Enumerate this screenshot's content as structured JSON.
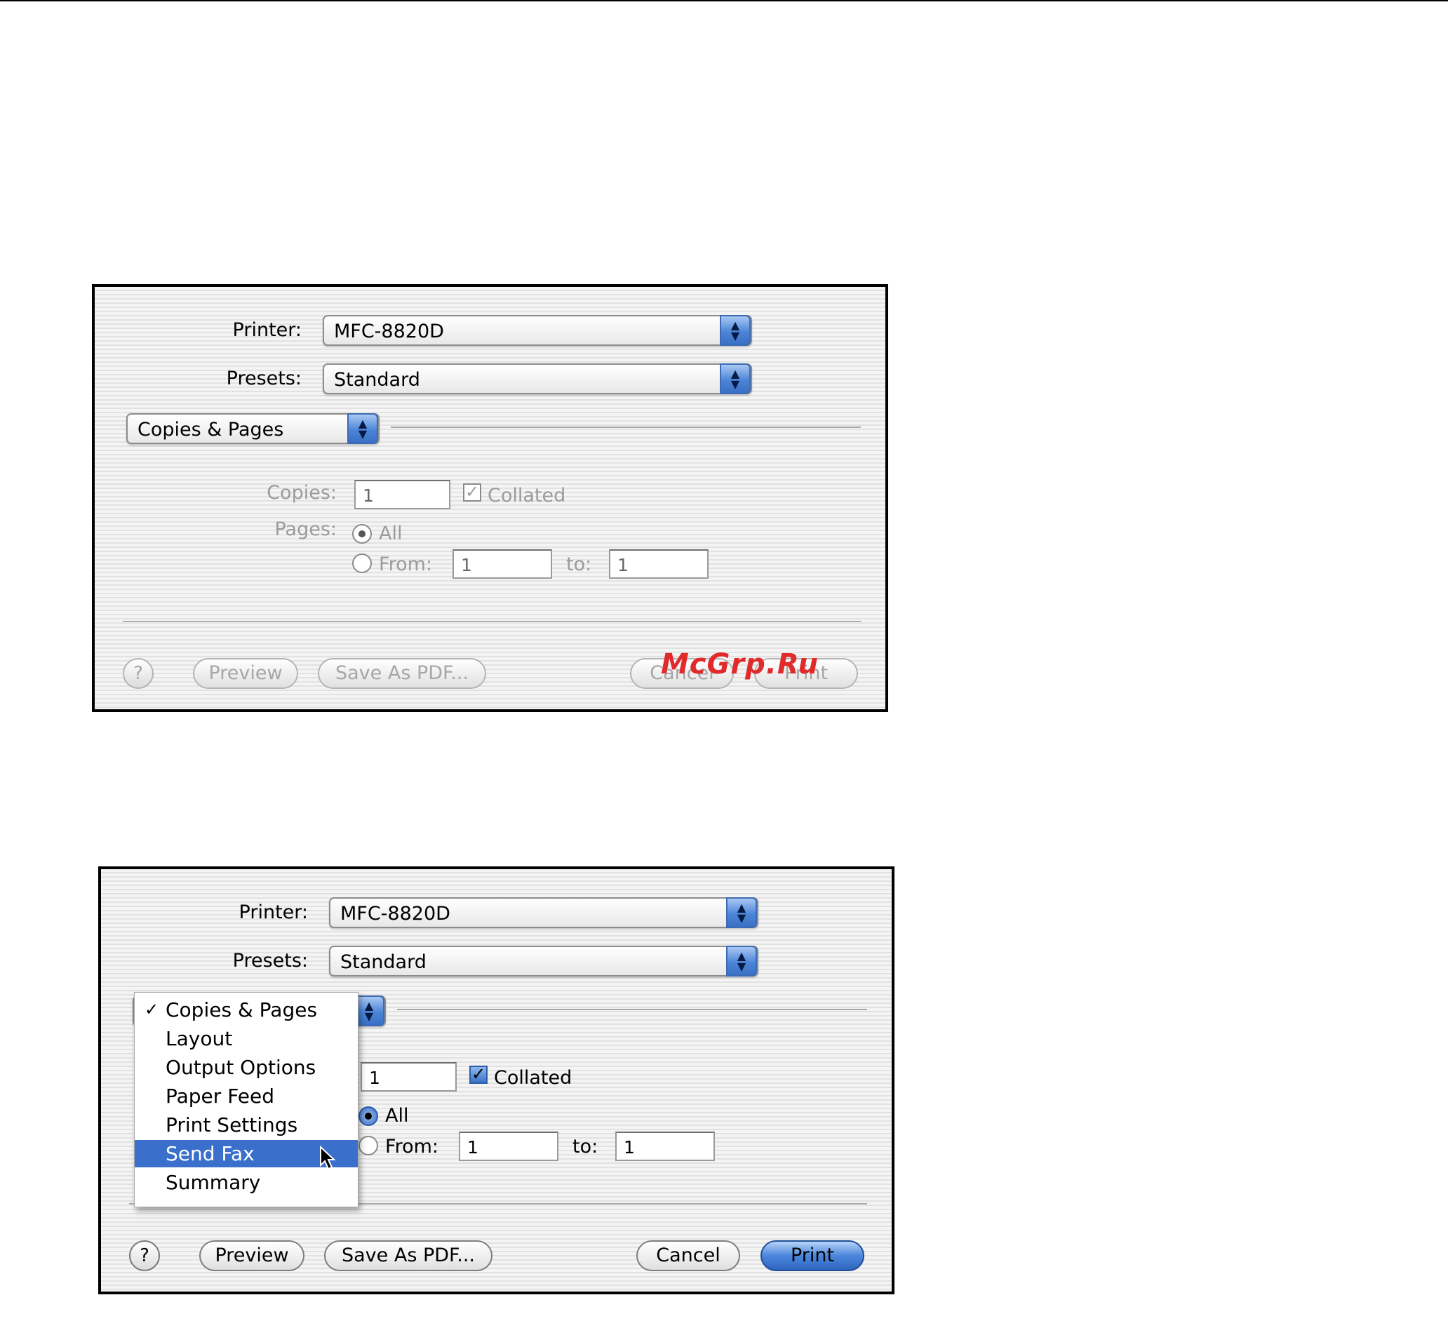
{
  "dialog1": {
    "printer_label": "Printer:",
    "printer_value": "MFC-8820D",
    "presets_label": "Presets:",
    "presets_value": "Standard",
    "pane_value": "Copies & Pages",
    "copies_label": "Copies:",
    "copies_value": "1",
    "collated_label": "Collated",
    "collated_checked": true,
    "pages_label": "Pages:",
    "all_label": "All",
    "from_label": "From:",
    "from_value": "1",
    "to_label": "to:",
    "to_value": "1",
    "help_label": "?",
    "preview_label": "Preview",
    "save_pdf_label": "Save As PDF...",
    "cancel_label": "Cancel",
    "print_label": "Print",
    "watermark": "McGrp.Ru"
  },
  "dialog2": {
    "printer_label": "Printer:",
    "printer_value": "MFC-8820D",
    "presets_label": "Presets:",
    "presets_value": "Standard",
    "copies_value": "1",
    "collated_label": "Collated",
    "collated_checked": true,
    "all_label": "All",
    "from_label": "From:",
    "from_value": "1",
    "to_label": "to:",
    "to_value": "1",
    "help_label": "?",
    "preview_label": "Preview",
    "save_pdf_label": "Save As PDF...",
    "cancel_label": "Cancel",
    "print_label": "Print",
    "menu": {
      "checkmark": "✓",
      "items": [
        "Copies & Pages",
        "Layout",
        "Output Options",
        "Paper Feed",
        "Print Settings",
        "Send Fax",
        "Summary"
      ],
      "checked_item": "Copies & Pages",
      "highlighted_item": "Send Fax"
    }
  },
  "icons": {
    "popup_arrows": "up-down-arrows-icon",
    "help": "question-mark-icon",
    "check": "checkmark-icon",
    "cursor": "mouse-pointer-icon"
  },
  "colors": {
    "accent_blue": "#3a6fcb",
    "disabled_text": "#9b9b9b",
    "watermark_red": "#e12a2a"
  }
}
